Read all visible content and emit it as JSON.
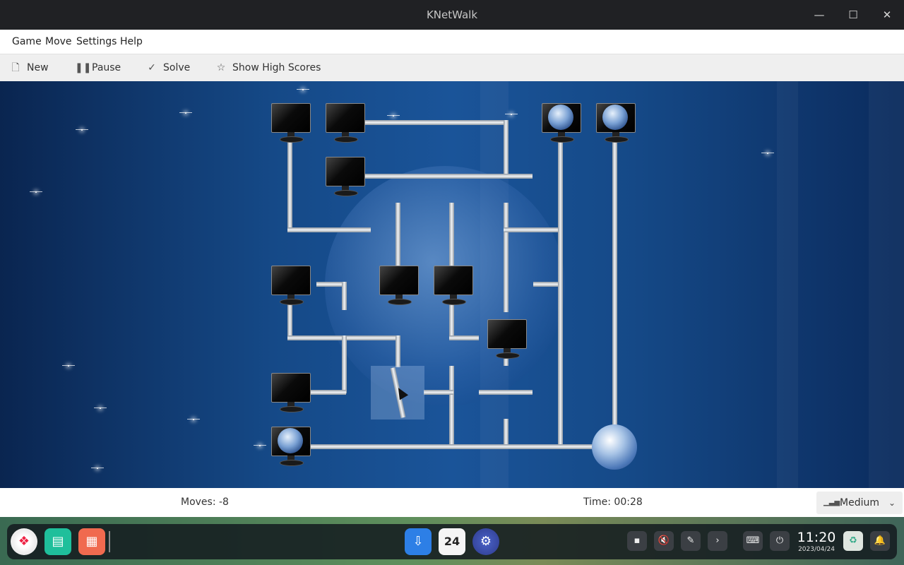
{
  "window": {
    "title": "KNetWalk"
  },
  "menu": [
    "Game",
    "Move",
    "Settings",
    "Help"
  ],
  "toolbar": {
    "new_label": "New",
    "pause_label": "Pause",
    "solve_label": "Solve",
    "highscores_label": "Show High Scores"
  },
  "status": {
    "moves": "Moves: -8",
    "time": "Time: 00:28",
    "difficulty": "Medium"
  },
  "taskbar": {
    "calendar_day": "24",
    "clock_time": "11:20",
    "clock_date": "2023/04/24"
  },
  "icons": {
    "new": "new-document-icon",
    "pause": "pause-icon",
    "solve": "checkmark-icon",
    "highscores": "star-icon"
  }
}
